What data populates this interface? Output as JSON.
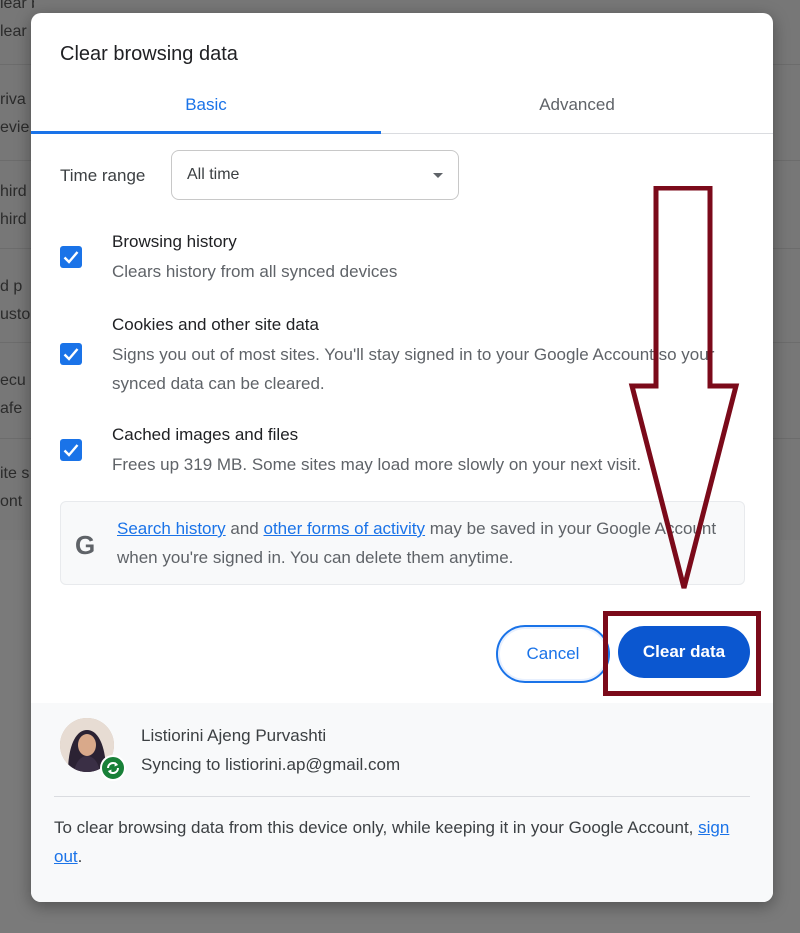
{
  "background": {
    "rows": [
      {
        "l1": "lear browsing data",
        "l2": "lear"
      },
      {
        "l1": "riva",
        "l2": "evie"
      },
      {
        "l1": "hird",
        "l2": "hird"
      },
      {
        "l1": "d p",
        "l2": "usto"
      },
      {
        "l1": "ecu",
        "l2": "afe"
      },
      {
        "l1": "ite s",
        "l2": "ont"
      }
    ]
  },
  "dialog": {
    "title": "Clear browsing data",
    "tabs": [
      {
        "label": "Basic",
        "active": true
      },
      {
        "label": "Advanced",
        "active": false
      }
    ],
    "time_range": {
      "label": "Time range",
      "value": "All time"
    },
    "options": [
      {
        "title": "Browsing history",
        "desc": "Clears history from all synced devices",
        "checked": true
      },
      {
        "title": "Cookies and other site data",
        "desc": "Signs you out of most sites. You'll stay signed in to your Google Account so your synced data can be cleared.",
        "checked": true
      },
      {
        "title": "Cached images and files",
        "desc": "Frees up 319 MB. Some sites may load more slowly on your next visit.",
        "checked": true
      }
    ],
    "info": {
      "icon": "google-g-icon",
      "link1": "Search history",
      "mid1": " and ",
      "link2": "other forms of activity",
      "rest": " may be saved in your Google Account when you're signed in. You can delete them anytime."
    },
    "buttons": {
      "cancel": "Cancel",
      "clear": "Clear data"
    },
    "account": {
      "name": "Listiorini Ajeng Purvashti",
      "sync": "Syncing to listiorini.ap@gmail.com",
      "note_prefix": "To clear browsing data from this device only, while keeping it in your Google Account, ",
      "note_link": "sign out",
      "note_suffix": "."
    }
  },
  "colors": {
    "accent": "#1a73e8",
    "primary_button": "#0b57d0",
    "annotation": "#7b0a1a"
  }
}
